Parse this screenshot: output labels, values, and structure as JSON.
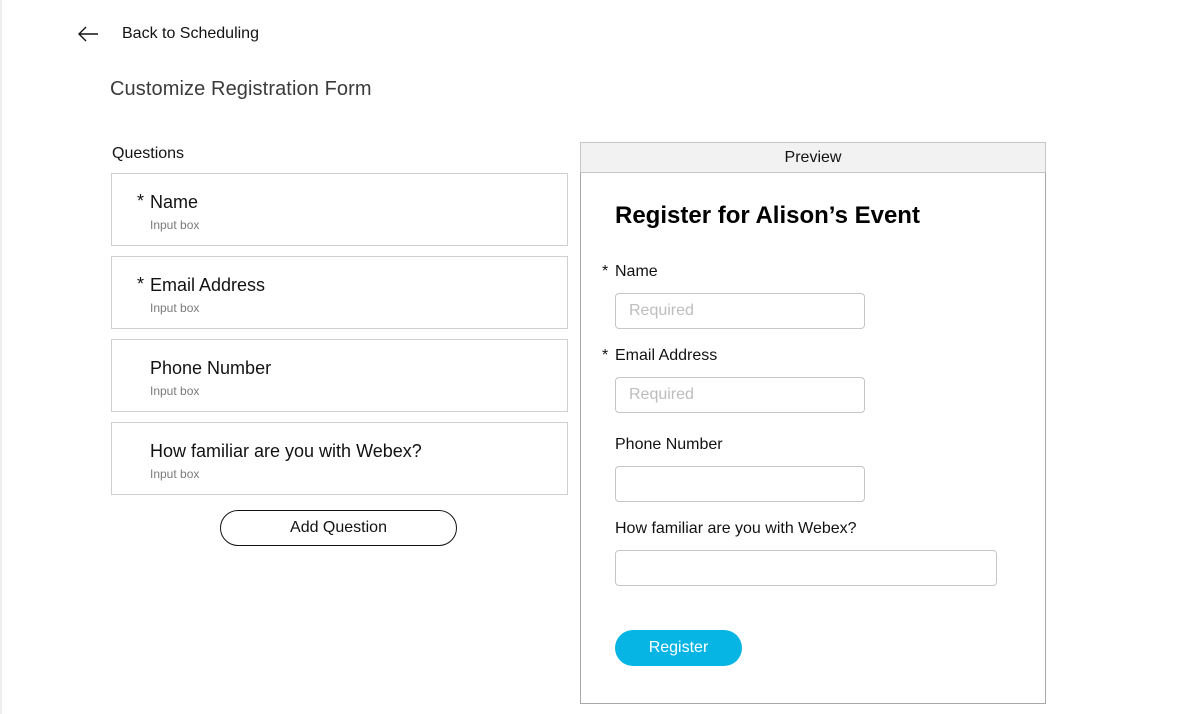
{
  "header": {
    "back_label": "Back to Scheduling",
    "back_icon": "arrow-left-icon",
    "page_title": "Customize Registration Form"
  },
  "questions": {
    "label": "Questions",
    "items": [
      {
        "required_mark": "*",
        "title": "Name",
        "type": "Input box"
      },
      {
        "required_mark": "*",
        "title": "Email Address",
        "type": "Input box"
      },
      {
        "required_mark": "",
        "title": "Phone Number",
        "type": "Input box"
      },
      {
        "required_mark": "",
        "title": "How familiar are you with Webex?",
        "type": "Input box"
      }
    ],
    "add_label": "Add Question"
  },
  "preview": {
    "header_label": "Preview",
    "title": "Register for Alison’s Event",
    "fields": [
      {
        "required_mark": "*",
        "label": "Name",
        "value": "",
        "placeholder": "Required"
      },
      {
        "required_mark": "*",
        "label": "Email Address",
        "value": "",
        "placeholder": "Required"
      },
      {
        "required_mark": "",
        "label": "Phone Number",
        "value": "",
        "placeholder": ""
      },
      {
        "required_mark": "",
        "label": "How familiar are you with Webex?",
        "value": "",
        "placeholder": ""
      }
    ],
    "register_label": "Register"
  },
  "colors": {
    "accent": "#07b5e4",
    "text": "#121212",
    "border": "#c6c6c6",
    "preview_header_bg": "#f2f2f2"
  }
}
